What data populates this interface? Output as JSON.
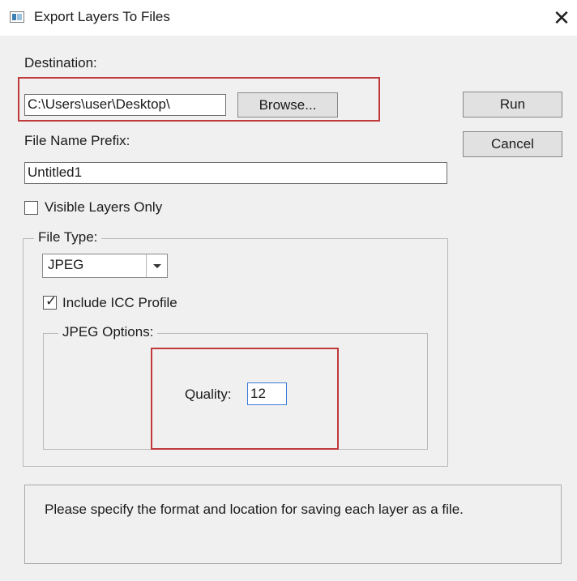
{
  "window": {
    "title": "Export Layers To Files",
    "icon": "photoshop-script-icon",
    "close_label": "✕"
  },
  "destination": {
    "label": "Destination:",
    "value": "C:\\Users\\user\\Desktop\\",
    "browse_label": "Browse..."
  },
  "buttons": {
    "run": "Run",
    "cancel": "Cancel"
  },
  "prefix": {
    "label": "File Name Prefix:",
    "value": "Untitled1"
  },
  "visible_only": {
    "label": "Visible Layers Only",
    "checked": false
  },
  "file_type": {
    "legend": "File Type:",
    "selected": "JPEG"
  },
  "icc": {
    "label": "Include ICC Profile",
    "checked": true,
    "mark": "✓"
  },
  "jpeg_options": {
    "legend": "JPEG Options:",
    "quality_label": "Quality:",
    "quality_value": "12"
  },
  "message": "Please specify the format and location for saving each layer as a file.",
  "colors": {
    "highlight": "#c0393b",
    "focus": "#3b7bd4"
  }
}
